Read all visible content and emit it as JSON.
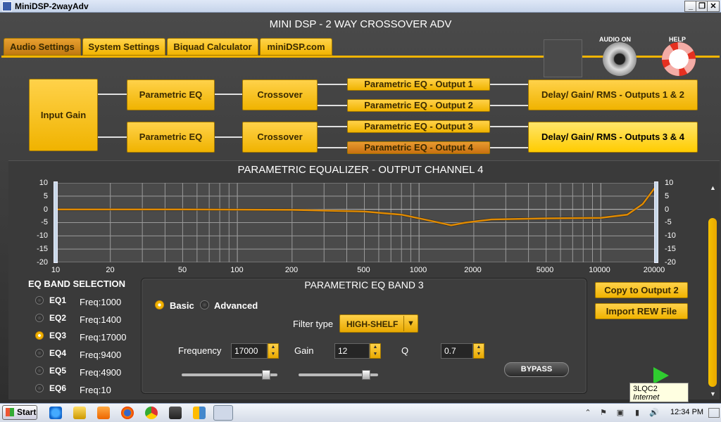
{
  "window": {
    "title": "MiniDSP-2wayAdv",
    "minimize": "_",
    "restore": "❐",
    "close": "✕"
  },
  "app": {
    "title": "MINI DSP - 2 WAY CROSSOVER ADV",
    "audio_on": "AUDIO ON",
    "help": "HELP"
  },
  "tabs": [
    "Audio Settings",
    "System Settings",
    "Biquad Calculator",
    "miniDSP.com"
  ],
  "routing": {
    "input_gain": "Input Gain",
    "peq": [
      "Parametric EQ",
      "Parametric EQ"
    ],
    "crossover": [
      "Crossover",
      "Crossover"
    ],
    "output_peq": [
      "Parametric EQ - Output 1",
      "Parametric EQ - Output 2",
      "Parametric EQ - Output 3",
      "Parametric EQ - Output 4"
    ],
    "delay": [
      "Delay/ Gain/ RMS - Outputs 1 & 2",
      "Delay/ Gain/ RMS - Outputs 3 & 4"
    ]
  },
  "graph": {
    "title": "PARAMETRIC EQUALIZER - OUTPUT CHANNEL 4",
    "y_ticks": [
      "10",
      "5",
      "0",
      "-5",
      "-10",
      "-15",
      "-20"
    ],
    "x_ticks": [
      "10",
      "20",
      "50",
      "100",
      "200",
      "500",
      "1000",
      "2000",
      "5000",
      "10000",
      "20000"
    ]
  },
  "chart_data": {
    "type": "line",
    "title": "PARAMETRIC EQUALIZER - OUTPUT CHANNEL 4",
    "xscale": "log",
    "xlim": [
      10,
      20000
    ],
    "ylim": [
      -20,
      10
    ],
    "grid": true,
    "x": [
      10,
      50,
      200,
      500,
      800,
      1100,
      1500,
      1800,
      2500,
      5000,
      10000,
      14000,
      17000,
      20000
    ],
    "y": [
      0,
      0,
      -0.2,
      -0.8,
      -2,
      -4,
      -6,
      -5,
      -3.8,
      -3.4,
      -3.2,
      -2,
      2,
      8.5
    ]
  },
  "bands": {
    "title": "EQ BAND SELECTION",
    "items": [
      {
        "label": "EQ1",
        "freq": "Freq:1000"
      },
      {
        "label": "EQ2",
        "freq": "Freq:1400"
      },
      {
        "label": "EQ3",
        "freq": "Freq:17000"
      },
      {
        "label": "EQ4",
        "freq": "Freq:9400"
      },
      {
        "label": "EQ5",
        "freq": "Freq:4900"
      },
      {
        "label": "EQ6",
        "freq": "Freq:10"
      }
    ],
    "selected": "EQ3"
  },
  "peq": {
    "title": "PARAMETRIC EQ BAND 3",
    "mode_basic": "Basic",
    "mode_advanced": "Advanced",
    "filter_type_label": "Filter type",
    "filter_type": "HIGH-SHELF",
    "frequency_label": "Frequency",
    "frequency": "17000",
    "gain_label": "Gain",
    "gain": "12",
    "q_label": "Q",
    "q": "0.7",
    "bypass": "BYPASS",
    "frequency_slider_level": 0.88,
    "gain_slider_level": 0.85
  },
  "side": {
    "copy": "Copy to Output 2",
    "import": "Import REW File"
  },
  "tooltip": {
    "line1": "3LQC2",
    "line2": "Internet access"
  },
  "taskbar": {
    "start": "Start",
    "clock": "12:34 PM"
  },
  "colors": {
    "accent": "#f0b300",
    "curve": "#e08a00"
  }
}
